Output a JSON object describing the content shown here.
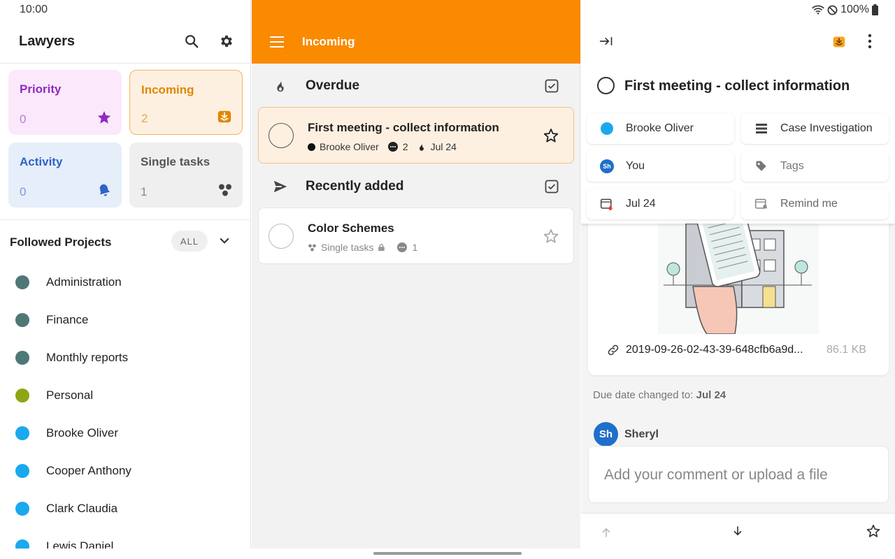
{
  "status_bar": {
    "time": "10:00",
    "battery": "100%"
  },
  "sidebar": {
    "workspace": "Lawyers",
    "cards": [
      {
        "label": "Priority",
        "count": "0",
        "color": "#8e2bc0"
      },
      {
        "label": "Incoming",
        "count": "2",
        "color": "#e08700"
      },
      {
        "label": "Activity",
        "count": "0",
        "color": "#2e63c8"
      },
      {
        "label": "Single tasks",
        "count": "1",
        "color": "#555555"
      }
    ],
    "followed_title": "Followed Projects",
    "all_label": "ALL",
    "projects": [
      {
        "label": "Administration",
        "color": "#4e7875"
      },
      {
        "label": "Finance",
        "color": "#4e7875"
      },
      {
        "label": "Monthly reports",
        "color": "#4e7875"
      },
      {
        "label": "Personal",
        "color": "#8fa514"
      },
      {
        "label": "Brooke Oliver",
        "color": "#1aa9ee"
      },
      {
        "label": "Cooper Anthony",
        "color": "#1aa9ee"
      },
      {
        "label": "Clark Claudia",
        "color": "#1aa9ee"
      },
      {
        "label": "Lewis Daniel",
        "color": "#1aa9ee"
      }
    ]
  },
  "middle": {
    "title": "Incoming",
    "accent": "#fa8a00",
    "sections": [
      {
        "title": "Overdue"
      },
      {
        "title": "Recently added"
      }
    ],
    "tasks": [
      {
        "title": "First meeting - collect information",
        "assignee": "Brooke Oliver",
        "comments": "2",
        "due": "Jul 24"
      },
      {
        "title": "Color Schemes",
        "project": "Single tasks",
        "comments": "1"
      }
    ]
  },
  "detail": {
    "title": "First meeting - collect information",
    "pills": {
      "assignee": "Brooke Oliver",
      "project": "Case Investigation",
      "owner": "You",
      "owner_avatar": "Sh",
      "tags": "Tags",
      "due": "Jul 24",
      "remind": "Remind me"
    },
    "attachment": {
      "name": "2019-09-26-02-43-39-648cfb6a9d...",
      "size": "86.1 KB"
    },
    "activity": {
      "prefix": "Due date changed to:",
      "value": "Jul 24"
    },
    "commenter": {
      "avatar": "Sh",
      "name": "Sheryl"
    },
    "comment_placeholder": "Add your comment or upload a file"
  }
}
